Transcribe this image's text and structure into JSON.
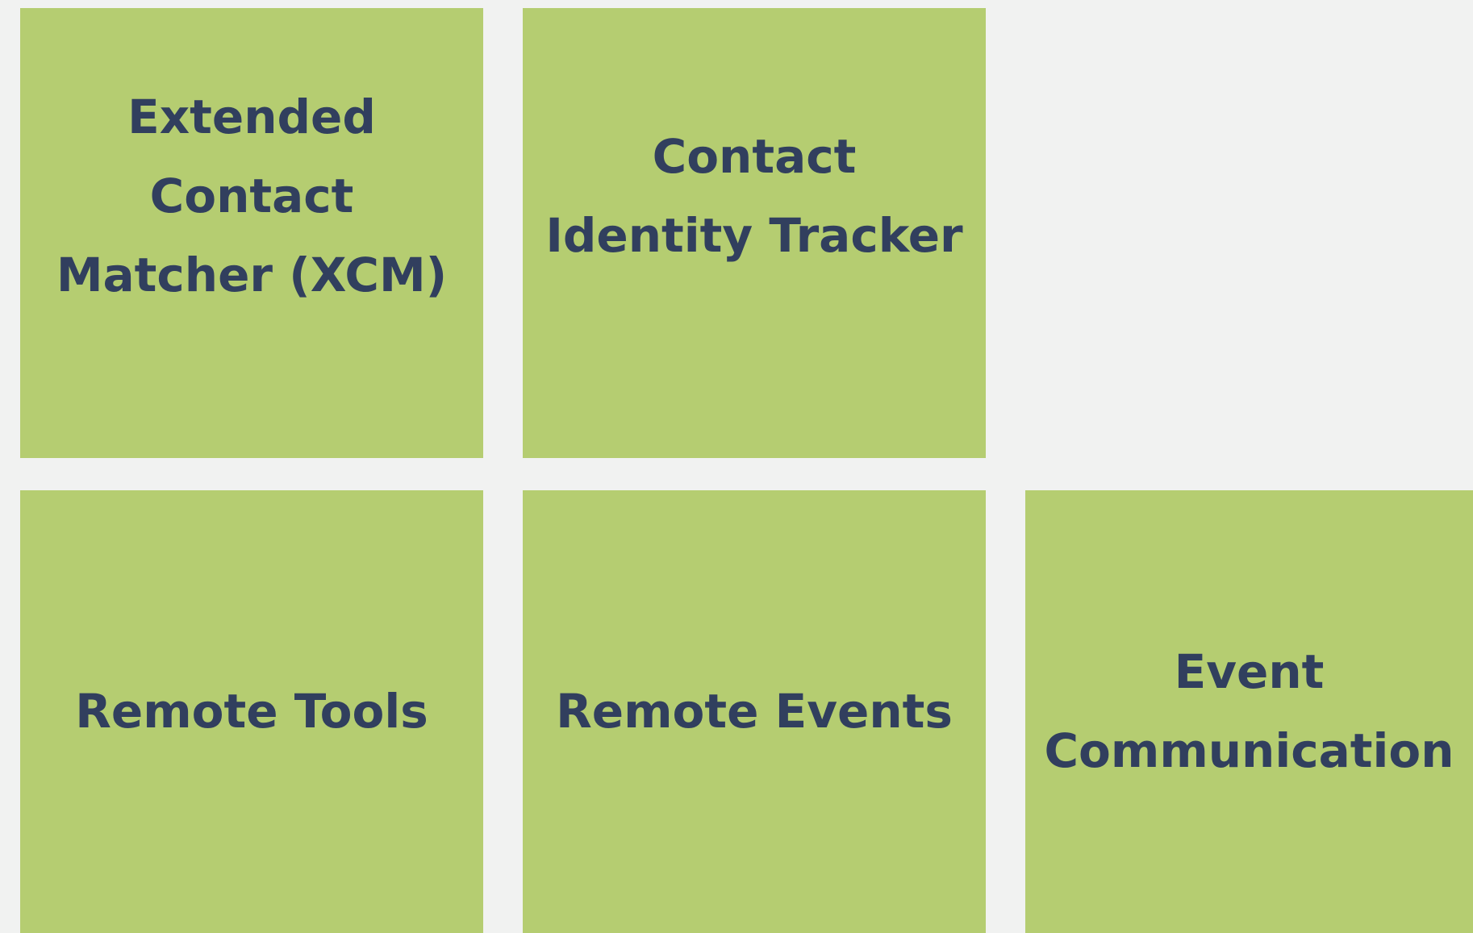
{
  "tiles": [
    {
      "label": "Extended\nContact\nMatcher (XCM)"
    },
    {
      "label": "Contact\nIdentity Tracker"
    },
    {
      "label": "Remote Tools"
    },
    {
      "label": "Remote Events"
    },
    {
      "label": "Event\nCommunication"
    }
  ],
  "colors": {
    "background": "#f1f2f1",
    "tile": "#b5cd71",
    "text": "#313f5e"
  }
}
